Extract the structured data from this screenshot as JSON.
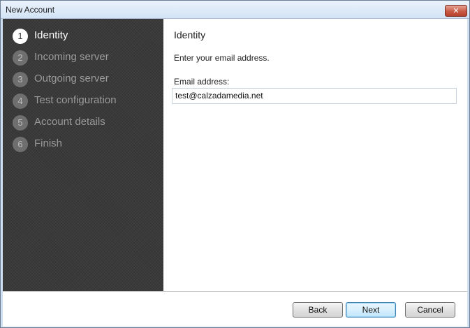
{
  "window": {
    "title": "New Account",
    "close_glyph": "✕"
  },
  "steps": [
    {
      "number": "1",
      "label": "Identity",
      "active": true
    },
    {
      "number": "2",
      "label": "Incoming server",
      "active": false
    },
    {
      "number": "3",
      "label": "Outgoing server",
      "active": false
    },
    {
      "number": "4",
      "label": "Test configuration",
      "active": false
    },
    {
      "number": "5",
      "label": "Account details",
      "active": false
    },
    {
      "number": "6",
      "label": "Finish",
      "active": false
    }
  ],
  "content": {
    "heading": "Identity",
    "instruction": "Enter your email address.",
    "email_label": "Email address:",
    "email_value": "test@calzadamedia.net"
  },
  "buttons": {
    "back": "Back",
    "next": "Next",
    "cancel": "Cancel"
  }
}
